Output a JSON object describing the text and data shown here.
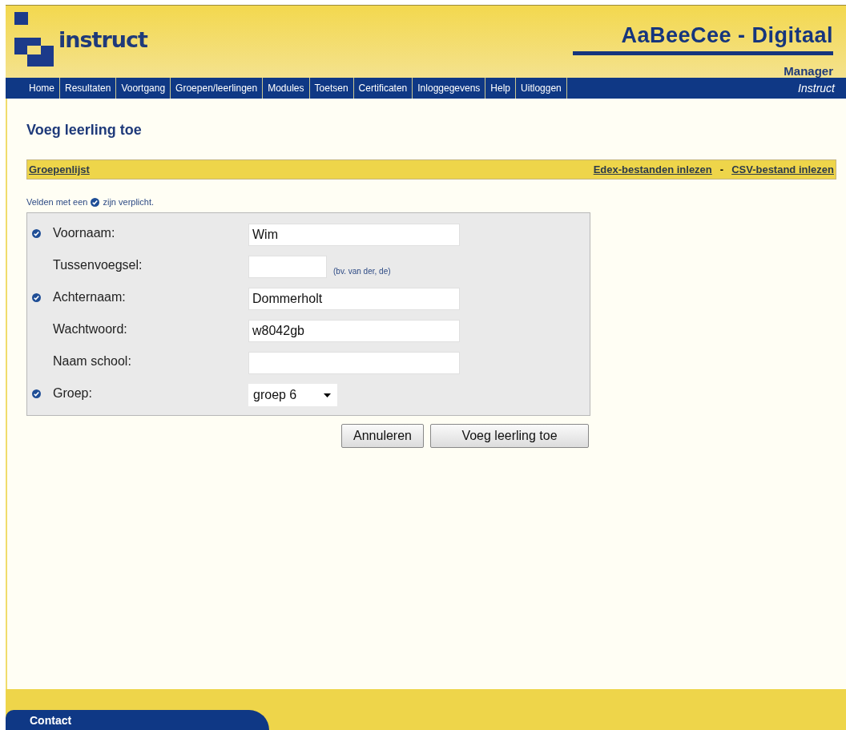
{
  "header": {
    "logo_text": "instruct",
    "product": "AaBeeCee - Digitaal",
    "role": "Manager"
  },
  "nav": {
    "items": [
      "Home",
      "Resultaten",
      "Voortgang",
      "Groepen/leerlingen",
      "Modules",
      "Toetsen",
      "Certificaten",
      "Inloggegevens",
      "Help",
      "Uitloggen"
    ],
    "brand": "Instruct"
  },
  "page_title": "Voeg leerling toe",
  "link_bar": {
    "left": "Groepenlijst",
    "right": [
      "Edex-bestanden inlezen",
      "CSV-bestand inlezen"
    ],
    "separator": "-"
  },
  "required_note": {
    "before": "Velden met een",
    "after": "zijn verplicht."
  },
  "fields": [
    {
      "label": "Voornaam:",
      "required": true,
      "kind": "text",
      "value": "Wim"
    },
    {
      "label": "Tussenvoegsel:",
      "required": false,
      "kind": "short-text",
      "hint": "(bv. van der, de)"
    },
    {
      "label": "Achternaam:",
      "required": true,
      "kind": "text",
      "value": "Dommerholt"
    },
    {
      "label": "Wachtwoord:",
      "required": false,
      "kind": "text",
      "value": "w8042gb"
    },
    {
      "label": "Naam school:",
      "required": false,
      "kind": "text"
    },
    {
      "label": "Groep:",
      "required": true,
      "kind": "select",
      "value": "groep 6"
    }
  ],
  "buttons": [
    "Annuleren",
    "Voeg leerling toe"
  ],
  "footer": {
    "tab": "Contact"
  }
}
